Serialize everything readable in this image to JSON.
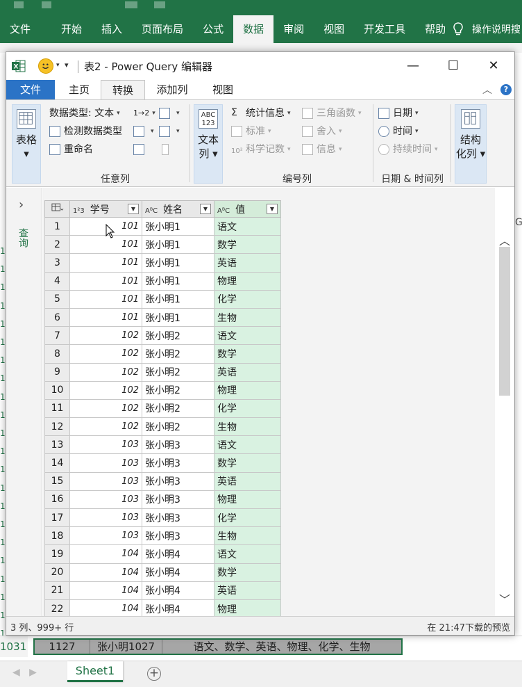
{
  "excel": {
    "tabs": [
      "文件",
      "开始",
      "插入",
      "页面布局",
      "公式",
      "数据",
      "审阅",
      "视图",
      "开发工具",
      "帮助"
    ],
    "active_tab": "数据",
    "tell_me": "操作说明搜",
    "column_letter": "G",
    "bottom_row": {
      "row_number": "1031",
      "cells": [
        "1127",
        "张小明1027",
        "语文、数学、英语、物理、化学、生物"
      ]
    },
    "sheet_tab": "Sheet1",
    "accent": "#217346"
  },
  "pq": {
    "title": "表2 - Power Query 编辑器",
    "tabs": {
      "file": "文件",
      "home": "主页",
      "transform": "转换",
      "add_column": "添加列",
      "view": "视图"
    },
    "ribbon": {
      "table_btn": "表格",
      "data_type": "数据类型: 文本",
      "detect_type": "检测数据类型",
      "rename": "重命名",
      "group_any": "任意列",
      "text_col_btn_l1": "文本",
      "text_col_btn_l2": "列",
      "stats": "统计信息",
      "standard": "标准",
      "scientific": "科学记数",
      "trig": "三角函数",
      "rounding": "舍入",
      "info": "信息",
      "group_number": "编号列",
      "date": "日期",
      "time": "时间",
      "duration": "持续时间",
      "group_datetime": "日期 & 时间列",
      "structured_l1": "结构",
      "structured_l2": "化列",
      "sub_1_2": "1→2"
    },
    "queries_label": "查询",
    "columns": [
      {
        "type": "1²3",
        "name": "学号"
      },
      {
        "type": "AᴮC",
        "name": "姓名"
      },
      {
        "type": "AᴮC",
        "name": "值"
      }
    ],
    "rows": [
      [
        "1",
        "101",
        "张小明1",
        "语文"
      ],
      [
        "2",
        "101",
        "张小明1",
        "数学"
      ],
      [
        "3",
        "101",
        "张小明1",
        "英语"
      ],
      [
        "4",
        "101",
        "张小明1",
        "物理"
      ],
      [
        "5",
        "101",
        "张小明1",
        "化学"
      ],
      [
        "6",
        "101",
        "张小明1",
        "生物"
      ],
      [
        "7",
        "102",
        "张小明2",
        "语文"
      ],
      [
        "8",
        "102",
        "张小明2",
        "数学"
      ],
      [
        "9",
        "102",
        "张小明2",
        "英语"
      ],
      [
        "10",
        "102",
        "张小明2",
        "物理"
      ],
      [
        "11",
        "102",
        "张小明2",
        "化学"
      ],
      [
        "12",
        "102",
        "张小明2",
        "生物"
      ],
      [
        "13",
        "103",
        "张小明3",
        "语文"
      ],
      [
        "14",
        "103",
        "张小明3",
        "数学"
      ],
      [
        "15",
        "103",
        "张小明3",
        "英语"
      ],
      [
        "16",
        "103",
        "张小明3",
        "物理"
      ],
      [
        "17",
        "103",
        "张小明3",
        "化学"
      ],
      [
        "18",
        "103",
        "张小明3",
        "生物"
      ],
      [
        "19",
        "104",
        "张小明4",
        "语文"
      ],
      [
        "20",
        "104",
        "张小明4",
        "数学"
      ],
      [
        "21",
        "104",
        "张小明4",
        "英语"
      ],
      [
        "22",
        "104",
        "张小明4",
        "物理"
      ]
    ],
    "status_left": "3 列、999+ 行",
    "status_right": "在 21:47下载的预览",
    "selected_col_color": "#d9f2e1"
  }
}
